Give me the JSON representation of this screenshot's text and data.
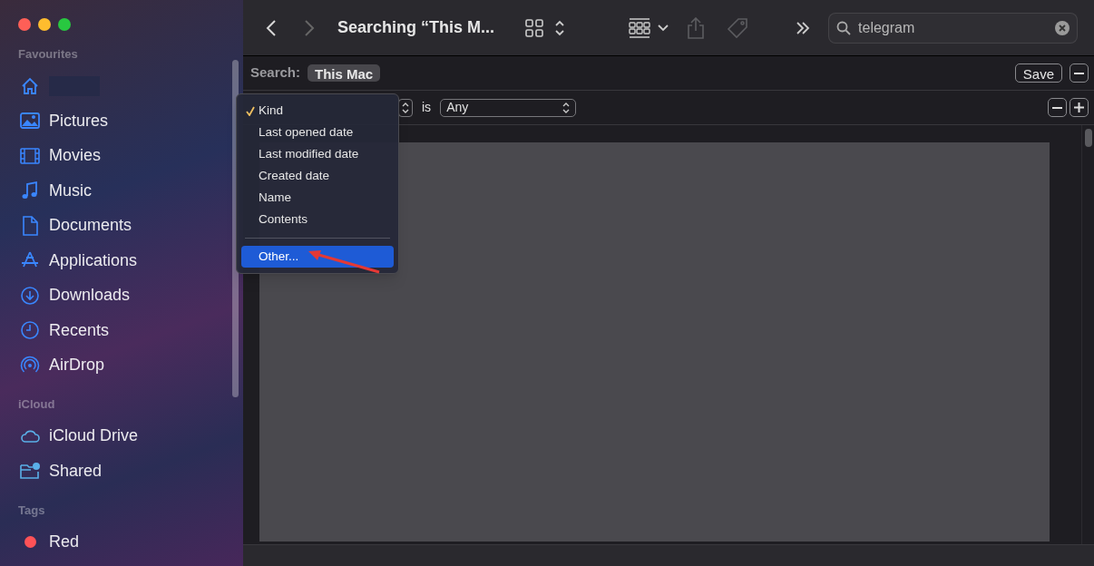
{
  "window": {
    "title": "Searching “This M..."
  },
  "sidebar": {
    "sections": [
      {
        "title": "Favourites",
        "items": [
          {
            "kind": "home",
            "redacted": true
          },
          {
            "kind": "pictures",
            "label": "Pictures"
          },
          {
            "kind": "movies",
            "label": "Movies"
          },
          {
            "kind": "music",
            "label": "Music"
          },
          {
            "kind": "documents",
            "label": "Documents"
          },
          {
            "kind": "applications",
            "label": "Applications"
          },
          {
            "kind": "downloads",
            "label": "Downloads"
          },
          {
            "kind": "recents",
            "label": "Recents"
          },
          {
            "kind": "airdrop",
            "label": "AirDrop"
          }
        ]
      },
      {
        "title": "iCloud",
        "items": [
          {
            "kind": "cloud",
            "label": "iCloud Drive"
          },
          {
            "kind": "shared",
            "label": "Shared"
          }
        ]
      },
      {
        "title": "Tags",
        "items": [
          {
            "kind": "tag",
            "label": "Red",
            "color": "#ff5257"
          }
        ]
      }
    ]
  },
  "search_field": {
    "value": "telegram"
  },
  "search_bar": {
    "label": "Search:",
    "scopes": [
      {
        "label": "This Mac",
        "selected": true
      }
    ],
    "save": "Save"
  },
  "criteria": {
    "connector": "is",
    "value": "Any"
  },
  "menu": {
    "items": [
      {
        "label": "Kind",
        "checked": true,
        "selected": false
      },
      {
        "label": "Last opened date",
        "checked": false,
        "selected": false
      },
      {
        "label": "Last modified date",
        "checked": false,
        "selected": false
      },
      {
        "label": "Created date",
        "checked": false,
        "selected": false
      },
      {
        "label": "Name",
        "checked": false,
        "selected": false
      },
      {
        "label": "Contents",
        "checked": false,
        "selected": false
      },
      {
        "label": "Other...",
        "checked": false,
        "selected": true,
        "separator_before": true
      }
    ]
  }
}
